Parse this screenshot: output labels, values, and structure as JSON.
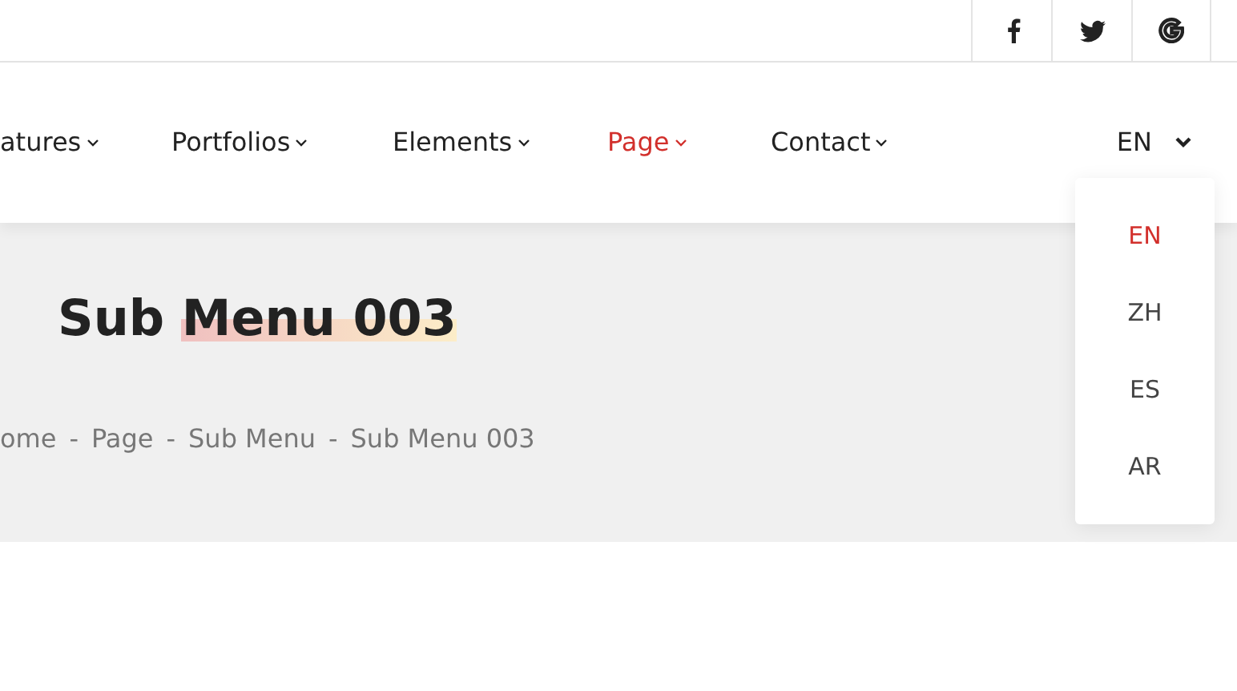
{
  "social": [
    {
      "kind": "facebook"
    },
    {
      "kind": "twitter"
    },
    {
      "kind": "google"
    }
  ],
  "nav": [
    {
      "label": "atures",
      "selected": false
    },
    {
      "label": "Portfolios",
      "selected": false
    },
    {
      "label": "Elements",
      "selected": false
    },
    {
      "label": "Page",
      "selected": true
    },
    {
      "label": "Contact",
      "selected": false
    }
  ],
  "language": {
    "current": "EN",
    "expanded": true,
    "options": [
      {
        "label": "EN",
        "selected": true
      },
      {
        "label": "ZH",
        "selected": false
      },
      {
        "label": "ES",
        "selected": false
      },
      {
        "label": "AR",
        "selected": false
      }
    ]
  },
  "title": {
    "lead": "Sub",
    "highlight": "Menu 003"
  },
  "breadcrumb": {
    "separator": "-",
    "items": [
      "ome",
      "Page",
      "Sub Menu",
      "Sub Menu 003"
    ]
  }
}
